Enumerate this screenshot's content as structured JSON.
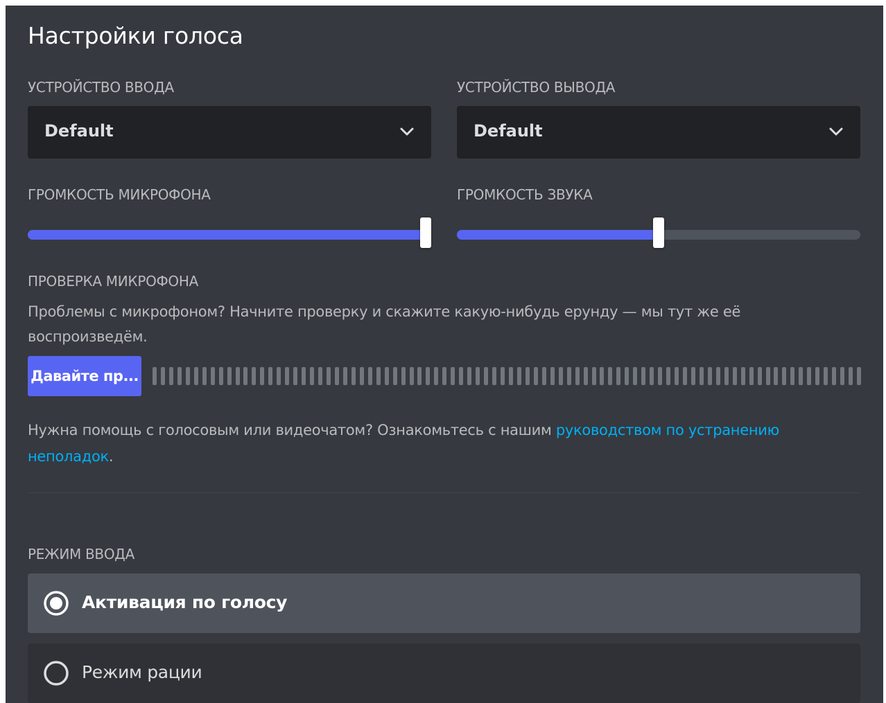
{
  "header": {
    "title": "Настройки голоса"
  },
  "input_device": {
    "label": "УСТРОЙСТВО ВВОДА",
    "value": "Default"
  },
  "output_device": {
    "label": "УСТРОЙСТВО ВЫВОДА",
    "value": "Default"
  },
  "mic_volume": {
    "label": "ГРОМКОСТЬ МИКРОФОНА",
    "level_percent": 98.6
  },
  "sound_volume": {
    "label": "ГРОМКОСТЬ ЗВУКА",
    "level_percent": 50
  },
  "mic_test": {
    "label": "ПРОВЕРКА МИКРОФОНА",
    "description": "Проблемы с микрофоном? Начните проверку и скажите какую-нибудь ерунду — мы тут же её воспроизведём.",
    "button_label": "Давайте пр...",
    "meter_bar_count": 86
  },
  "help": {
    "text_before": "Нужна помощь с голосовым или видеочатом? Ознакомьтесь с нашим ",
    "link_text": "руководством по устранению неполадок",
    "text_after": "."
  },
  "input_mode": {
    "label": "РЕЖИМ ВВОДА",
    "options": [
      {
        "label": "Активация по голосу",
        "selected": true
      },
      {
        "label": "Режим рации",
        "selected": false
      }
    ]
  },
  "colors": {
    "background": "#36393f",
    "select_bg": "#202225",
    "accent": "#5865f2",
    "link": "#00aff4",
    "text_muted": "#b9bbbe"
  },
  "icons": {
    "select_chevron": "chevron-down-icon",
    "radio_selected": "radio-checked-icon",
    "radio_unselected": "radio-unchecked-icon"
  }
}
